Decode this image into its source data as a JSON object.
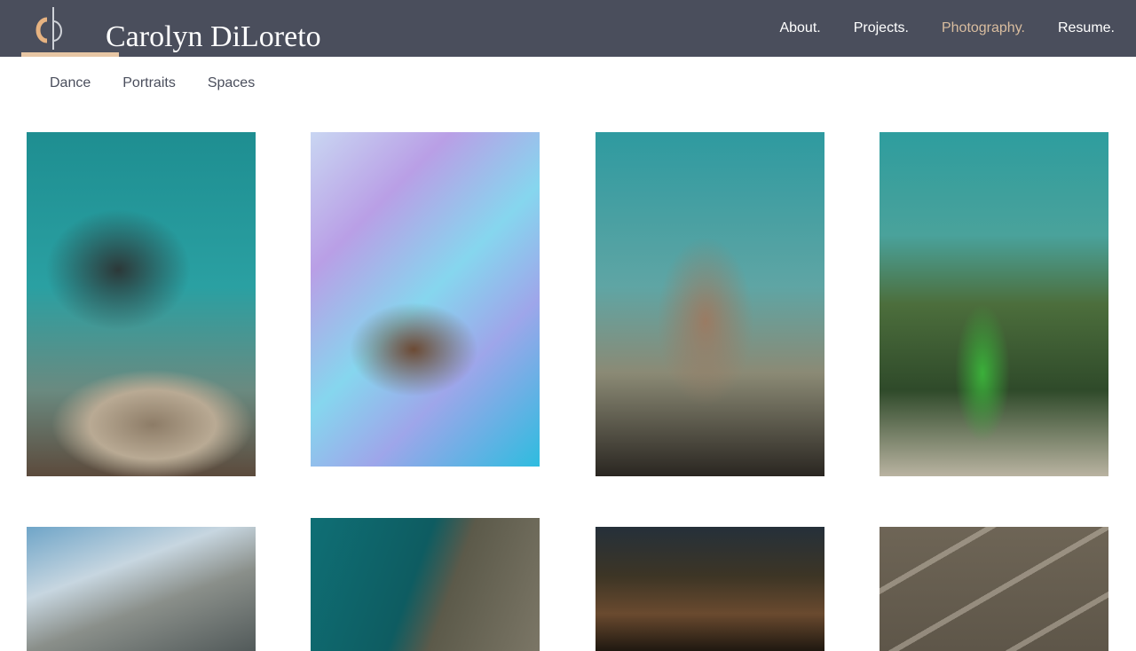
{
  "header": {
    "brand_name": "Carolyn DiLoreto",
    "logo": {
      "icon": "cd-monogram-logo",
      "accent_color": "#e7c6a4"
    },
    "background_color": "#4a4e5c",
    "nav": [
      {
        "label": "About.",
        "active": false
      },
      {
        "label": "Projects.",
        "active": false
      },
      {
        "label": "Photography.",
        "active": true
      },
      {
        "label": "Resume.",
        "active": false
      }
    ],
    "active_color": "#d9bd9f"
  },
  "subnav": [
    {
      "label": "Dance"
    },
    {
      "label": "Portraits"
    },
    {
      "label": "Spaces"
    }
  ]
}
